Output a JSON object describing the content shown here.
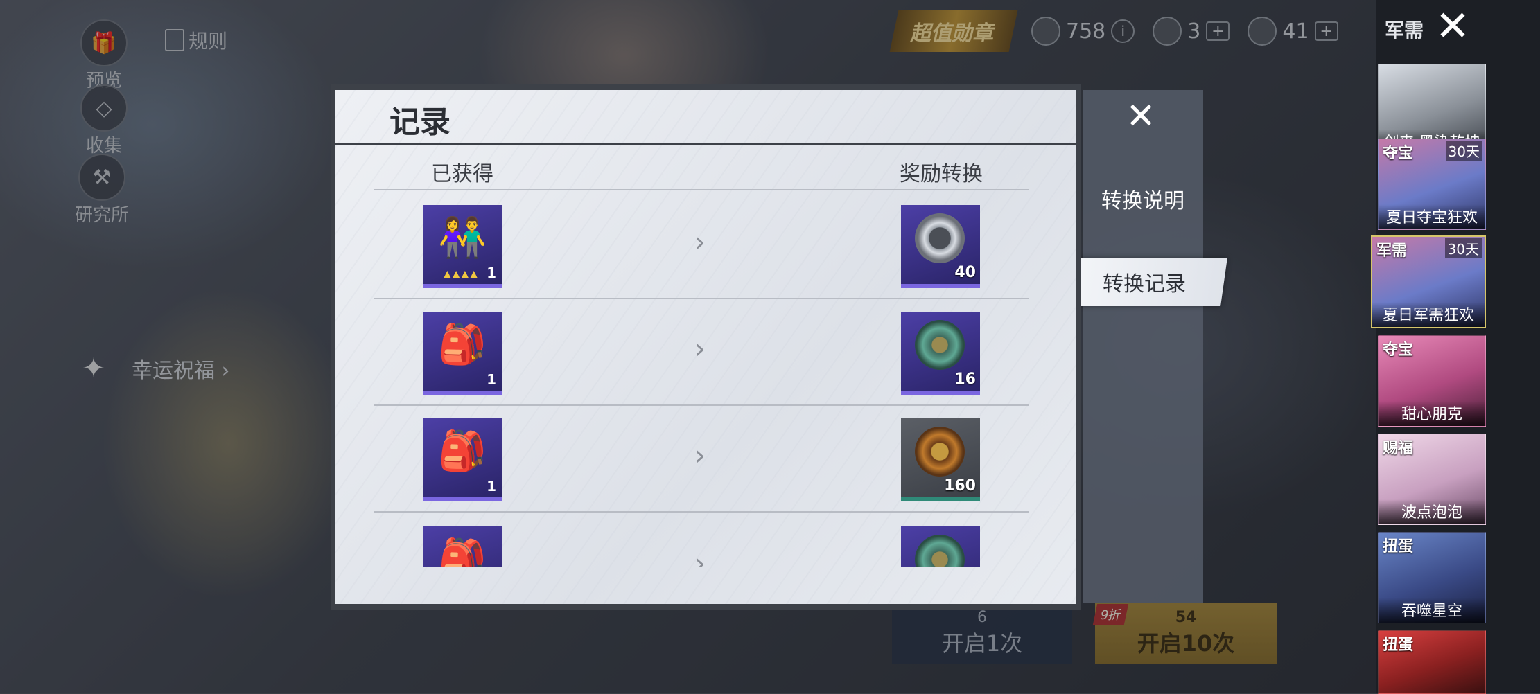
{
  "background": {
    "left_menu": [
      {
        "id": "preview",
        "label": "预览",
        "icon": "gift-icon"
      },
      {
        "id": "collect",
        "label": "收集",
        "icon": "diamond-icon"
      },
      {
        "id": "lab",
        "label": "研究所",
        "icon": "wrench-icon"
      }
    ],
    "rules_label": "规则",
    "lucky_label": "幸运祝福 ›",
    "top_bar": {
      "medal_label": "超值勋章",
      "currency_a": "758",
      "currency_b": "3",
      "currency_c": "41"
    },
    "open_once": {
      "cost": "6",
      "label": "开启1次"
    },
    "open_ten": {
      "cost": "54",
      "label": "开启10次",
      "discount": "9折"
    }
  },
  "right_panel": {
    "title": "军需",
    "cards": [
      {
        "tag": "",
        "days": "",
        "name": "剑来 墨染乾坤"
      },
      {
        "tag": "夺宝",
        "days": "30天",
        "name": "夏日夺宝狂欢"
      },
      {
        "tag": "军需",
        "days": "30天",
        "name": "夏日军需狂欢"
      },
      {
        "tag": "夺宝",
        "days": "",
        "name": "甜心朋克"
      },
      {
        "tag": "赐福",
        "days": "",
        "name": "波点泡泡"
      },
      {
        "tag": "扭蛋",
        "days": "",
        "name": "吞噬星空"
      },
      {
        "tag": "扭蛋",
        "days": "",
        "name": ""
      }
    ]
  },
  "side_tabs": {
    "explain": "转换说明",
    "record": "转换记录"
  },
  "dialog": {
    "title": "记录",
    "col_obtained": "已获得",
    "col_conversion": "奖励转换",
    "rows": [
      {
        "item_icon": "outfit-icon",
        "item_qty": "1",
        "reward_icon": "silver-coin-icon",
        "reward_qty": "40",
        "reward_style": "silver"
      },
      {
        "item_icon": "backpack-icon",
        "item_qty": "1",
        "reward_icon": "jade-medal-icon",
        "reward_qty": "16",
        "reward_style": "jade"
      },
      {
        "item_icon": "backpack-icon",
        "item_qty": "1",
        "reward_icon": "bronze-medal-icon",
        "reward_qty": "160",
        "reward_style": "bronze"
      },
      {
        "item_icon": "backpack-icon",
        "item_qty": "",
        "reward_icon": "jade-medal-icon",
        "reward_qty": "",
        "reward_style": "jade"
      }
    ]
  },
  "colors": {
    "dialog_bg": "#e6e9ee",
    "item_bg": "#3a3296",
    "item_border": "#7a66e0",
    "gold_button": "#a8893a"
  }
}
